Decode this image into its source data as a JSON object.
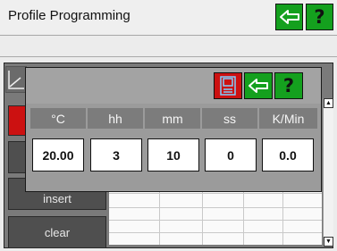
{
  "window": {
    "title": "Profile Programming"
  },
  "toolbar": {
    "back_icon": "back-arrow-icon",
    "help_label": "?"
  },
  "left_panel": {
    "insert_label": "insert",
    "clear_label": "clear"
  },
  "dialog": {
    "save_icon": "save-disk-icon",
    "back_icon": "back-arrow-icon",
    "help_label": "?",
    "headers": [
      "°C",
      "hh",
      "mm",
      "ss",
      "K/Min"
    ],
    "values": [
      "20.00",
      "3",
      "10",
      "0",
      "0.0"
    ]
  },
  "colors": {
    "accent_green": "#14a01e",
    "accent_red": "#cc1111",
    "header_gray": "#7c7c7c"
  }
}
